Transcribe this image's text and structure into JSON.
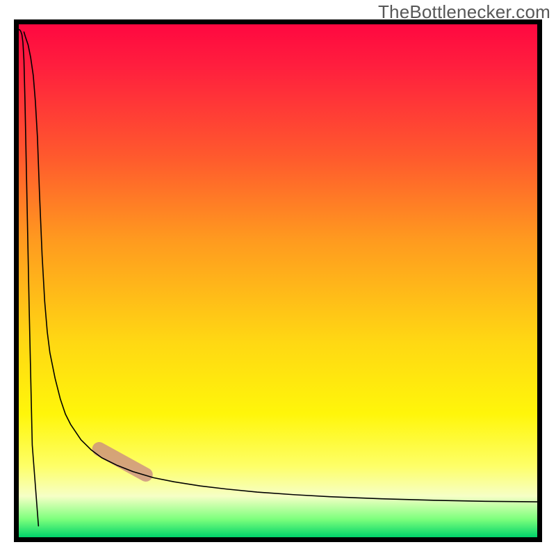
{
  "watermark": "TheBottlenecker.com",
  "chart_data": {
    "type": "line",
    "title": "",
    "xlabel": "",
    "ylabel": "",
    "xlim": [
      0,
      100
    ],
    "ylim": [
      0,
      100
    ],
    "grid": false,
    "legend": false,
    "background_gradient": {
      "orientation": "vertical",
      "stops": [
        {
          "pos": 0.0,
          "color": "#ff0840"
        },
        {
          "pos": 0.26,
          "color": "#ff5a2d"
        },
        {
          "pos": 0.62,
          "color": "#ffd813"
        },
        {
          "pos": 0.86,
          "color": "#feff66"
        },
        {
          "pos": 0.96,
          "color": "#7cff7c"
        },
        {
          "pos": 1.0,
          "color": "#00d36b"
        }
      ]
    },
    "series": [
      {
        "name": "bottleneck-curve",
        "x": [
          1.0,
          1.3,
          1.8,
          2.3,
          2.8,
          3.2,
          3.6,
          4.0,
          4.5,
          5.0,
          5.5,
          6.0,
          7.0,
          8.0,
          9.0,
          10.0,
          12.0,
          14.0,
          16.0,
          19.0,
          22.0,
          26.0,
          30.0,
          35.0,
          40.0,
          46.0,
          53.0,
          60.0,
          70.0,
          80.0,
          90.0,
          100.0
        ],
        "y": [
          98.5,
          97.5,
          96.0,
          93.5,
          90.0,
          85.0,
          78.0,
          67.0,
          55.0,
          46.0,
          40.0,
          36.0,
          31.0,
          27.0,
          24.0,
          22.0,
          19.0,
          17.0,
          15.5,
          14.0,
          12.8,
          11.6,
          10.8,
          10.0,
          9.4,
          8.8,
          8.3,
          7.9,
          7.5,
          7.2,
          7.0,
          6.9
        ]
      },
      {
        "name": "left-spike",
        "x": [
          0.0,
          0.2,
          0.4,
          0.6,
          0.8,
          1.0,
          1.2,
          1.5,
          2.0,
          2.6,
          3.8
        ],
        "y": [
          99.0,
          98.9,
          98.6,
          98.0,
          96.5,
          93.0,
          85.0,
          70.0,
          45.0,
          18.0,
          2.2
        ]
      }
    ],
    "highlight": {
      "name": "marker-segment",
      "x_range": [
        15.5,
        24.5
      ],
      "y_range": [
        17.2,
        12.2
      ],
      "color": "#c98b82"
    }
  }
}
